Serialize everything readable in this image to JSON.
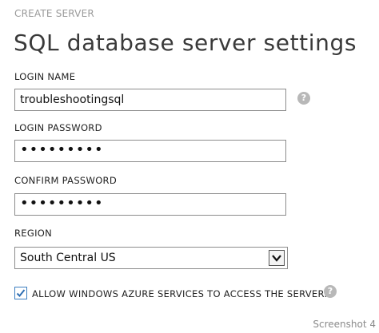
{
  "header": {
    "eyebrow": "CREATE SERVER",
    "title": "SQL database server settings"
  },
  "form": {
    "login_name": {
      "label": "LOGIN NAME",
      "value": "troubleshootingsql"
    },
    "login_password": {
      "label": "LOGIN PASSWORD",
      "value": "•••••••••"
    },
    "confirm_password": {
      "label": "CONFIRM PASSWORD",
      "value": "•••••••••"
    },
    "region": {
      "label": "REGION",
      "selected": "South Central US"
    },
    "allow_azure": {
      "label": "ALLOW WINDOWS AZURE SERVICES TO ACCESS THE SERVER.",
      "checked": true
    },
    "help_glyph": "?"
  },
  "watermark": "Screenshot 4",
  "colors": {
    "checkbox_accent": "#3d7fc1",
    "help_icon": "#b8b8b8"
  }
}
